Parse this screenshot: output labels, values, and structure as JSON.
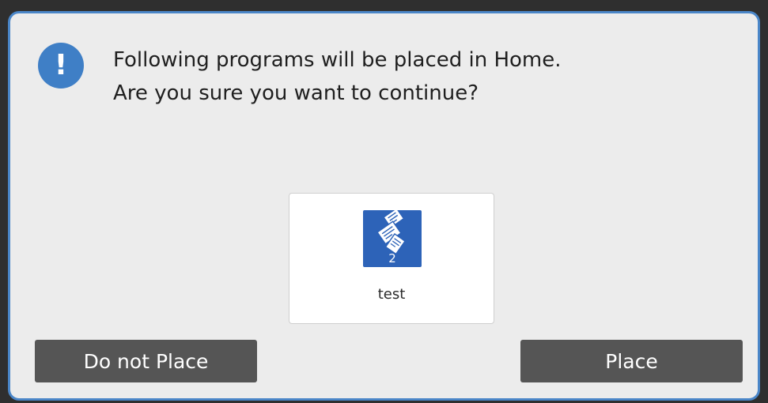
{
  "dialog": {
    "message_line1": "Following programs will be placed in Home.",
    "message_line2": "Are you sure you want to continue?",
    "alert_icon": "exclamation-icon",
    "alert_glyph": "!"
  },
  "program": {
    "name": "test",
    "count": "2",
    "icon": "copy-documents-icon"
  },
  "buttons": {
    "do_not_place": "Do not Place",
    "place": "Place"
  },
  "colors": {
    "accent": "#4a86c8",
    "alert_icon_bg": "#3f7fc6",
    "program_icon_bg": "#2d63b8",
    "button_bg": "#555555",
    "dialog_bg": "#ececec"
  }
}
